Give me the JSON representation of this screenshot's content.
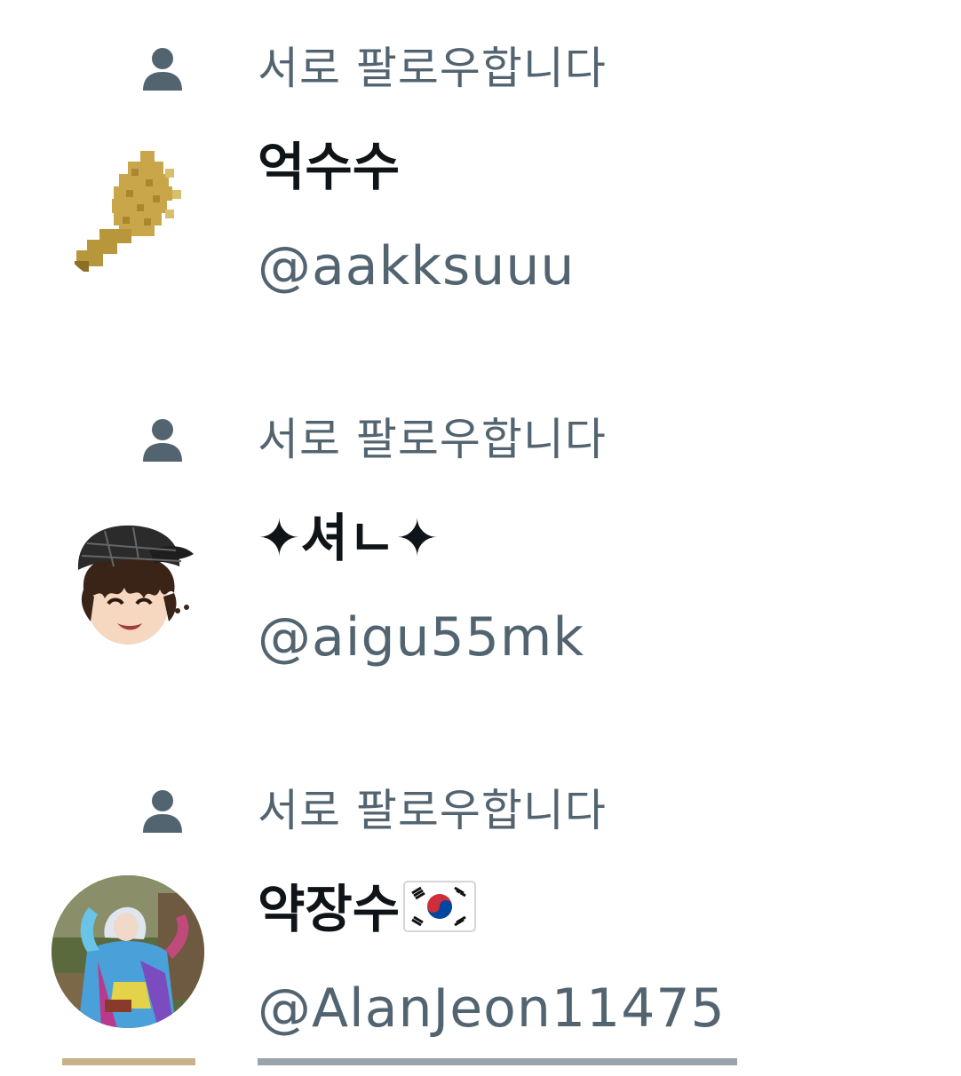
{
  "colors": {
    "secondary_text": "#536471",
    "primary_text": "#0f1419",
    "background": "#ffffff"
  },
  "follow_list": [
    {
      "social_context_icon": "person-icon",
      "social_context": "서로 팔로우합니다",
      "display_name": "억수수",
      "handle": "@aakksuuu",
      "avatar": "pixel-corn-avatar"
    },
    {
      "social_context_icon": "person-icon",
      "social_context": "서로 팔로우합니다",
      "display_name": "✦셔ㄴ✦",
      "handle": "@aigu55mk",
      "avatar": "cartoon-boy-cap-avatar"
    },
    {
      "social_context_icon": "person-icon",
      "social_context": "서로 팔로우합니다",
      "display_name": "약장수",
      "display_name_emoji": "south-korea-flag-icon",
      "handle": "@AlanJeon11475",
      "avatar": "costume-photo-avatar"
    }
  ]
}
